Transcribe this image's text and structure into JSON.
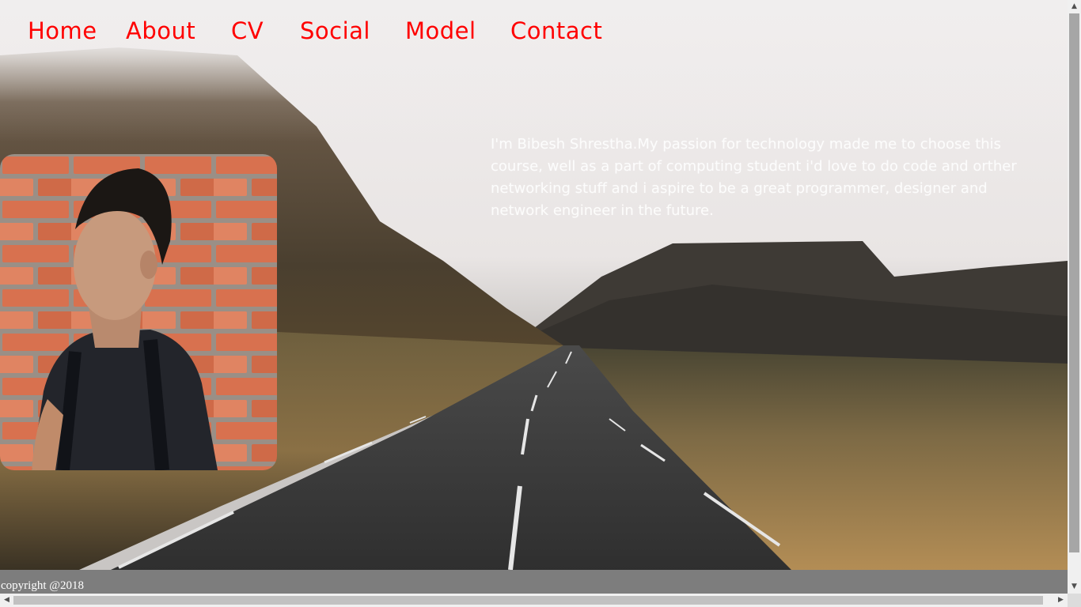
{
  "nav": {
    "items": [
      {
        "label": "Home"
      },
      {
        "label": "About"
      },
      {
        "label": "CV"
      },
      {
        "label": "Social"
      },
      {
        "label": "Model"
      },
      {
        "label": "Contact"
      }
    ]
  },
  "hero": {
    "bio": "I'm Bibesh Shrestha.My passion for technology made me to choose this course, well as a part of computing student i'd love to do code and orther networking stuff and i aspire to be a great programmer, designer and network engineer in the future."
  },
  "footer": {
    "copyright": "copyright @2018"
  },
  "colors": {
    "nav_link": "#ff0000",
    "footer_bg": "#7d7d7d",
    "bio_text": "#ffffff"
  }
}
